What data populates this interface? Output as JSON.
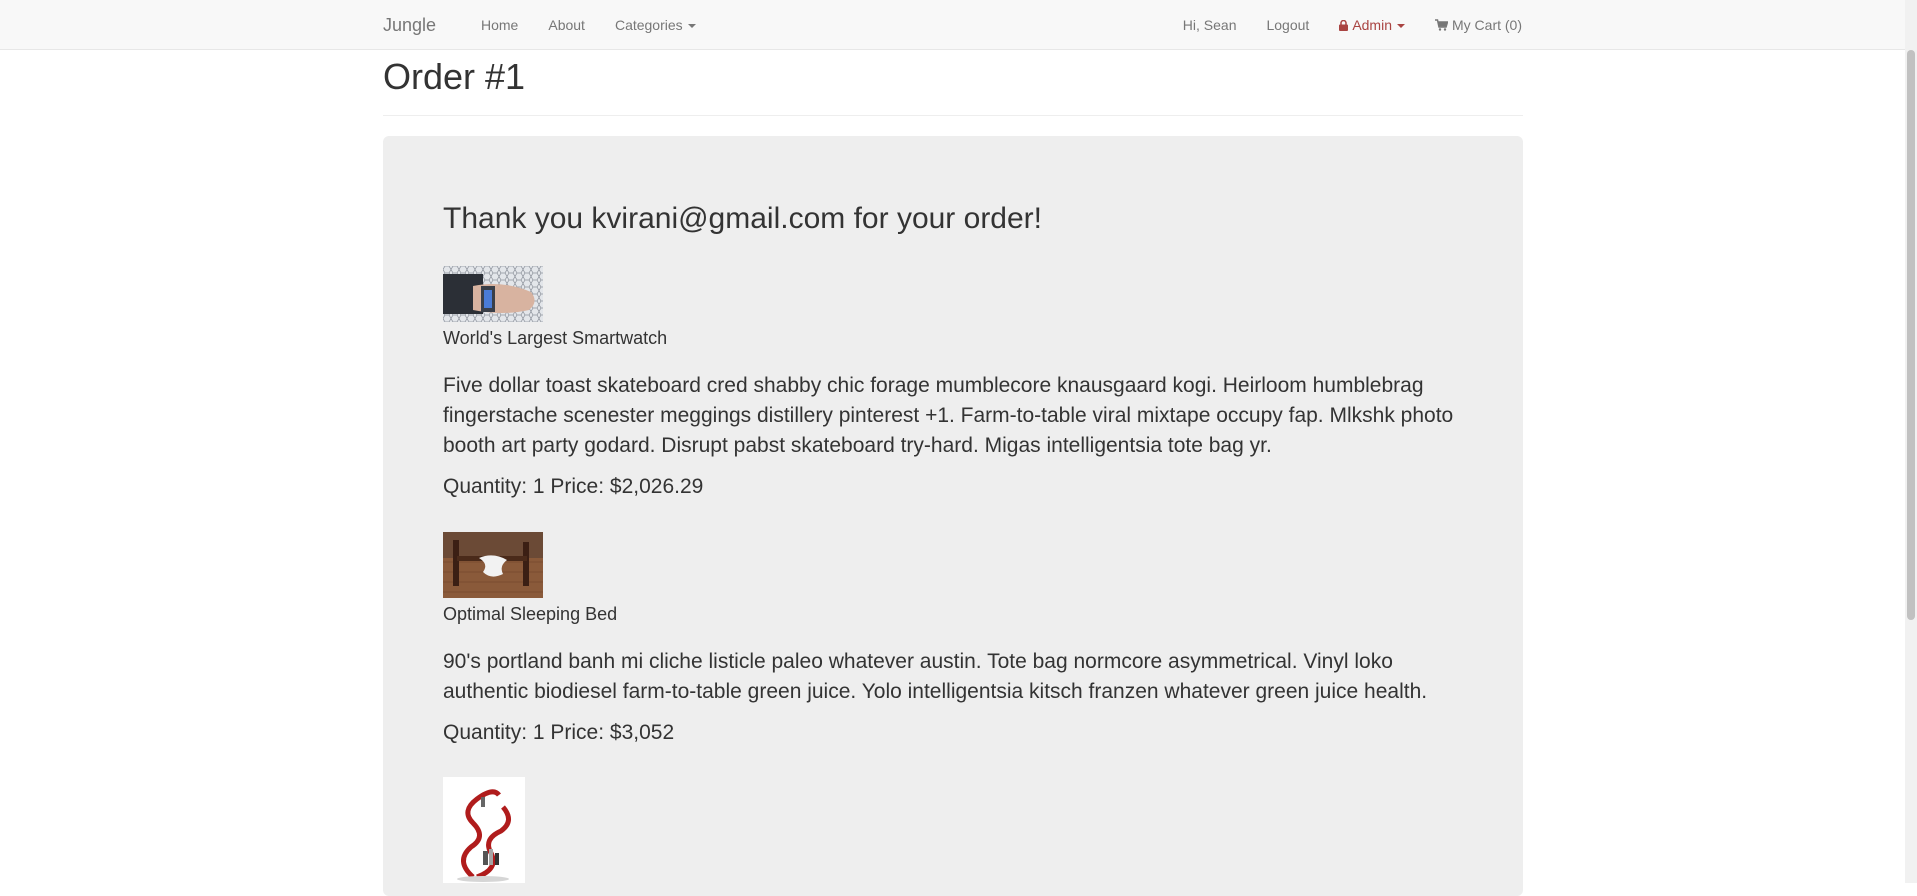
{
  "nav": {
    "brand": "Jungle",
    "home": "Home",
    "about": "About",
    "categories": "Categories",
    "greeting": "Hi, Sean",
    "logout": "Logout",
    "admin": "Admin",
    "cart": "My Cart (0)",
    "admin_color": "#a94442"
  },
  "page": {
    "title": "Order #1",
    "thanks": "Thank you kvirani@gmail.com for your order!"
  },
  "items": [
    {
      "name": "World's Largest Smartwatch",
      "description": "Five dollar toast skateboard cred shabby chic forage mumblecore knausgaard kogi. Heirloom humblebrag fingerstache scenester meggings distillery pinterest +1. Farm-to-table viral mixtape occupy fap. Mlkshk photo booth art party godard. Disrupt pabst skateboard try-hard. Migas intelligentsia tote bag yr.",
      "quantity_line": "Quantity: 1 Price: $2,026.29"
    },
    {
      "name": "Optimal Sleeping Bed",
      "description": "90's portland banh mi cliche listicle paleo whatever austin. Tote bag normcore asymmetrical. Vinyl loko authentic biodiesel farm-to-table green juice. Yolo intelligentsia kitsch franzen whatever green juice health.",
      "quantity_line": "Quantity: 1 Price: $3,052"
    }
  ]
}
